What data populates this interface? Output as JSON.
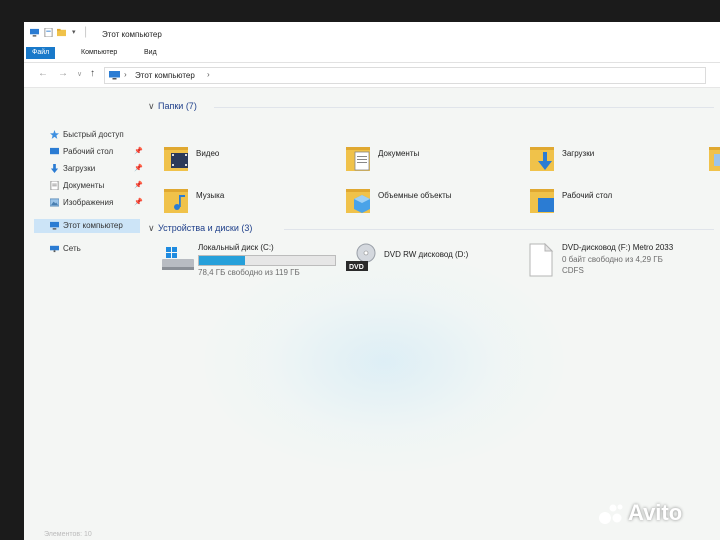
{
  "window": {
    "title": "Этот компьютер"
  },
  "ribbon": {
    "tabs": [
      "Файл",
      "Компьютер",
      "Вид"
    ]
  },
  "address_bar": {
    "path": "Этот компьютер"
  },
  "sidebar": {
    "quick_access": "Быстрый доступ",
    "pinned": [
      {
        "label": "Рабочий стол",
        "icon": "desktop-icon"
      },
      {
        "label": "Загрузки",
        "icon": "download-icon"
      },
      {
        "label": "Документы",
        "icon": "documents-icon"
      },
      {
        "label": "Изображения",
        "icon": "pictures-icon"
      }
    ],
    "this_pc": "Этот компьютер",
    "network": "Сеть"
  },
  "folders": {
    "header": "Папки (7)",
    "items": [
      {
        "label": "Видео",
        "icon": "video-folder-icon"
      },
      {
        "label": "Документы",
        "icon": "documents-folder-icon"
      },
      {
        "label": "Загрузки",
        "icon": "downloads-folder-icon"
      },
      {
        "label": "Музыка",
        "icon": "music-folder-icon"
      },
      {
        "label": "Объемные объекты",
        "icon": "3d-objects-folder-icon"
      },
      {
        "label": "Рабочий стол",
        "icon": "desktop-folder-icon"
      }
    ]
  },
  "devices": {
    "header": "Устройства и диски (3)",
    "items": [
      {
        "name": "Локальный диск (C:)",
        "free": "78,4 ГБ свободно из 119 ГБ",
        "used_fraction": 0.34,
        "icon": "hard-drive-icon"
      },
      {
        "name": "DVD RW дисковод (D:)",
        "icon": "dvd-drive-icon"
      },
      {
        "name": "DVD-дисковод (F:) Metro 2033",
        "free": "0 байт свободно из 4,29 ГБ",
        "fs": "CDFS",
        "icon": "disc-file-icon"
      }
    ]
  },
  "status": {
    "elements": "Элементов: 10"
  },
  "watermark": {
    "text": "Avito"
  },
  "colors": {
    "accent": "#1979ca",
    "drive_bar": "#26a0da",
    "folder": "#f0c24a"
  }
}
